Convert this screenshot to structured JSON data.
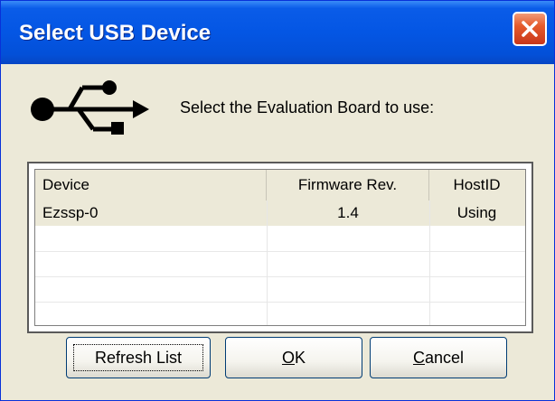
{
  "window": {
    "title": "Select USB Device"
  },
  "prompt": "Select the Evaluation Board to use:",
  "icons": {
    "usb": "usb-icon",
    "close": "close-icon"
  },
  "table": {
    "columns": [
      "Device",
      "Firmware Rev.",
      "HostID"
    ],
    "rows": [
      {
        "device": "Ezssp-0",
        "firmware": "1.4",
        "hostid": "Using"
      }
    ]
  },
  "buttons": {
    "refresh": "Refresh List",
    "ok_mnemonic": "O",
    "ok_rest": "K",
    "cancel_mnemonic": "C",
    "cancel_rest": "ancel"
  },
  "colors": {
    "titlebar": "#0456e4",
    "close": "#e55b2c",
    "face": "#ece9d8"
  }
}
